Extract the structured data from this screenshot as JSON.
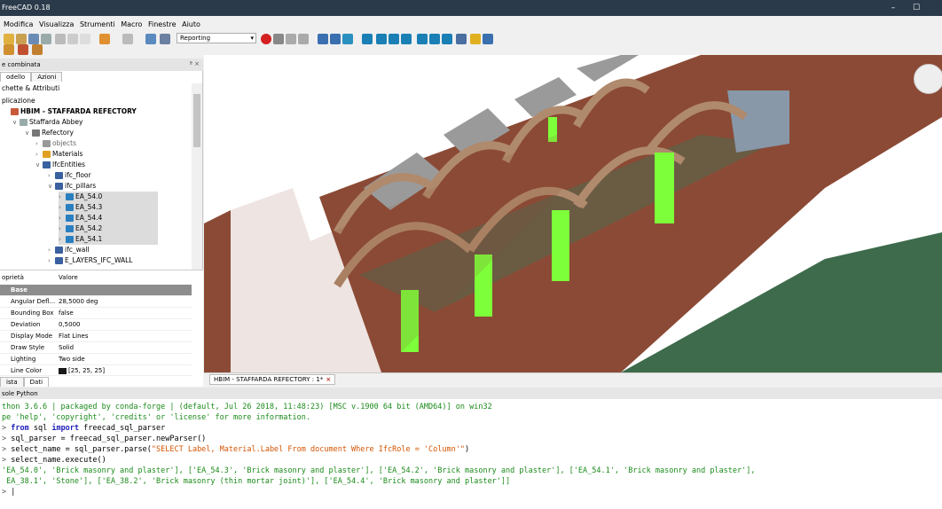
{
  "window": {
    "title": "FreeCAD 0.18",
    "min": "–",
    "max": "☐"
  },
  "menu": [
    "Modifica",
    "Visualizza",
    "Strumenti",
    "Macro",
    "Finestre",
    "Aiuto"
  ],
  "toolbar": {
    "workbench": "Reporting"
  },
  "combo": {
    "title": "Vista combinata",
    "title_visible": "e combinata",
    "tabs": [
      "odello",
      "Azioni"
    ],
    "section_labels": "chette & Attributi",
    "app_label": "plicazione"
  },
  "tree": {
    "doc": "HBIM - STAFFARDA REFECTORY",
    "abbey": "Staffarda Abbey",
    "refectory": "Refectory",
    "objects": "objects",
    "materials": "Materials",
    "ifcentities": "IfcEntities",
    "ifc_floor": "ifc_floor",
    "ifc_pillars": "ifc_pillars",
    "pillars": [
      "EA_54.0",
      "EA_54.3",
      "EA_54.4",
      "EA_54.2",
      "EA_54.1"
    ],
    "ifc_wall": "ifc_wall",
    "layers": "E_LAYERS_IFC_WALL"
  },
  "props": {
    "col_name": "oprietà",
    "col_value": "Valore",
    "group": "Base",
    "rows": [
      {
        "name": "Angular Defl...",
        "value": "28,5000 deg"
      },
      {
        "name": "Bounding Box",
        "value": "false"
      },
      {
        "name": "Deviation",
        "value": "0,5000"
      },
      {
        "name": "Display Mode",
        "value": "Flat Lines"
      },
      {
        "name": "Draw Style",
        "value": "Solid"
      },
      {
        "name": "Lighting",
        "value": "Two side"
      },
      {
        "name": "Line Color",
        "value": "[25, 25, 25]"
      }
    ],
    "tabs": [
      "ista",
      "Dati"
    ]
  },
  "view_tab": "HBIM - STAFFARDA REFECTORY : 1*",
  "console": {
    "header": "sole Python",
    "lines": [
      "thon 3.6.6 | packaged by conda-forge | (default, Jul 26 2018, 11:48:23) [MSC v.1900 64 bit (AMD64)] on win32",
      "pe 'help', 'copyright', 'credits' or 'license' for more information."
    ],
    "cmd1_kw1": "from",
    "cmd1_mid": " sql ",
    "cmd1_kw2": "import",
    "cmd1_end": " freecad_sql_parser",
    "cmd2": "sql_parser = freecad_sql_parser.newParser()",
    "cmd3_pre": "select_name = sql_parser.parse(",
    "cmd3_str": "\"SELECT Label, Material.Label From document Where IfcRole = 'Column'\"",
    "cmd3_post": ")",
    "cmd4": "select_name.execute()",
    "out1": "'EA_54.0', 'Brick masonry and plaster'], ['EA_54.3', 'Brick masonry and plaster'], ['EA_54.2', 'Brick masonry and plaster'], ['EA_54.1', 'Brick masonry and plaster'],",
    "out2": " EA_38.1', 'Stone'], ['EA_38.2', 'Brick masonry (thin mortar joint)'], ['EA_54.4', 'Brick masonry and plaster']]",
    "prompt": ">"
  },
  "colors": {
    "brick": "#8a4a36",
    "pillar": "#7dff3a",
    "ground": "#3d6b4b",
    "arch": "#b08a6c"
  }
}
